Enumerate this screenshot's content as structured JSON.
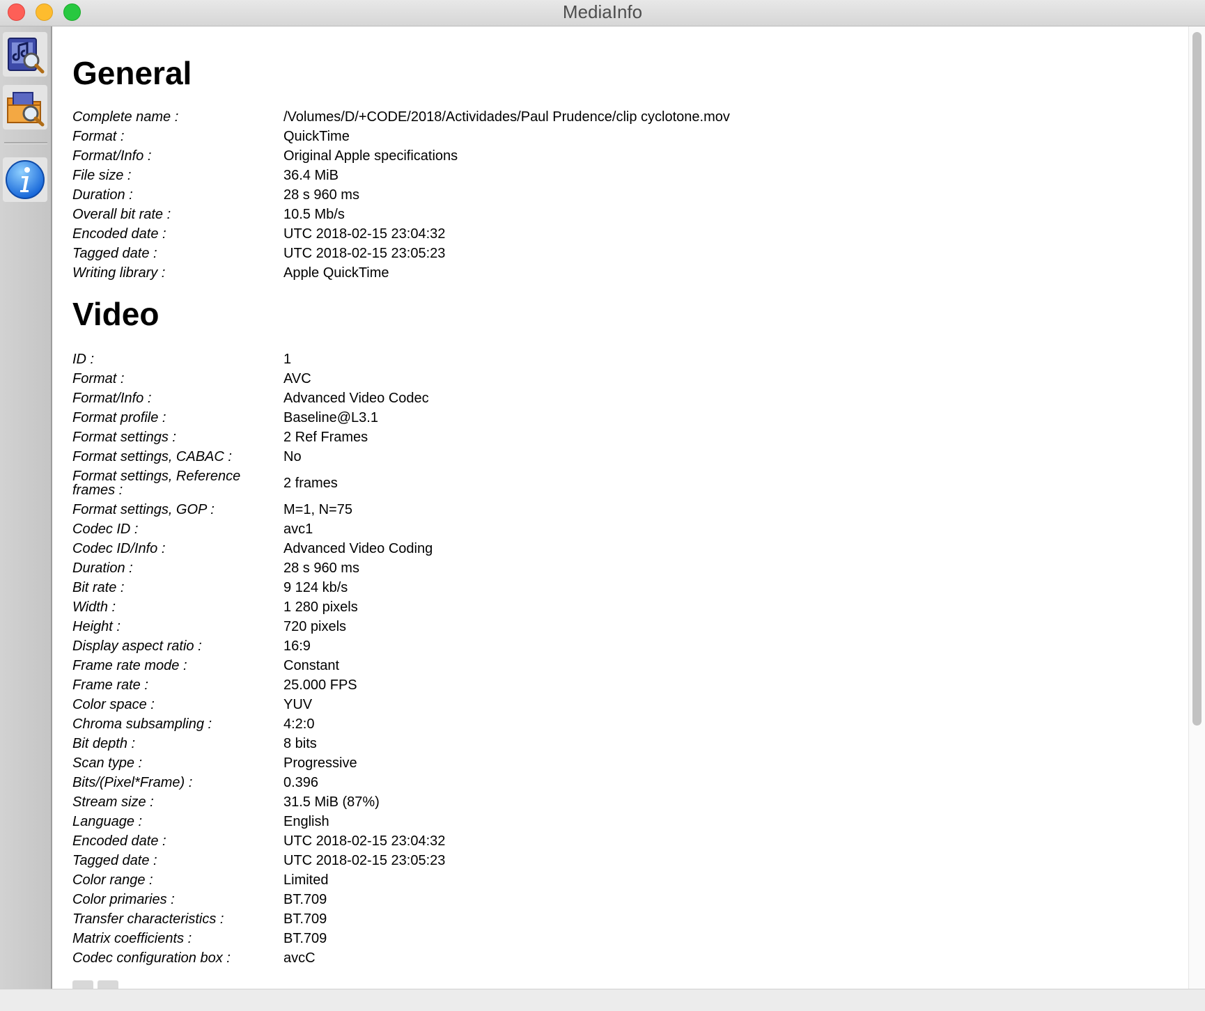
{
  "window": {
    "title": "MediaInfo"
  },
  "sidebar": {
    "buttons": [
      {
        "icon": "open-file-icon"
      },
      {
        "icon": "open-folder-icon"
      },
      {
        "icon": "info-icon"
      }
    ]
  },
  "general": {
    "heading": "General",
    "rows": [
      {
        "label": "Complete name :",
        "value": "/Volumes/D/+CODE/2018/Actividades/Paul Prudence/clip cyclotone.mov"
      },
      {
        "label": "Format :",
        "value": "QuickTime"
      },
      {
        "label": "Format/Info :",
        "value": "Original Apple specifications"
      },
      {
        "label": "File size :",
        "value": "36.4 MiB"
      },
      {
        "label": "Duration :",
        "value": "28 s 960 ms"
      },
      {
        "label": "Overall bit rate :",
        "value": "10.5 Mb/s"
      },
      {
        "label": "Encoded date :",
        "value": "UTC 2018-02-15 23:04:32"
      },
      {
        "label": "Tagged date :",
        "value": "UTC 2018-02-15 23:05:23"
      },
      {
        "label": "Writing library :",
        "value": "Apple QuickTime"
      }
    ]
  },
  "video": {
    "heading": "Video",
    "rows": [
      {
        "label": "ID :",
        "value": "1"
      },
      {
        "label": "Format :",
        "value": "AVC"
      },
      {
        "label": "Format/Info :",
        "value": "Advanced Video Codec"
      },
      {
        "label": "Format profile :",
        "value": "Baseline@L3.1"
      },
      {
        "label": "Format settings :",
        "value": "2 Ref Frames"
      },
      {
        "label": "Format settings, CABAC :",
        "value": "No"
      },
      {
        "label": "Format settings, Reference frames :",
        "value": "2 frames"
      },
      {
        "label": "Format settings, GOP :",
        "value": "M=1, N=75"
      },
      {
        "label": "Codec ID :",
        "value": "avc1"
      },
      {
        "label": "Codec ID/Info :",
        "value": "Advanced Video Coding"
      },
      {
        "label": "Duration :",
        "value": "28 s 960 ms"
      },
      {
        "label": "Bit rate :",
        "value": "9 124 kb/s"
      },
      {
        "label": "Width :",
        "value": "1 280 pixels"
      },
      {
        "label": "Height :",
        "value": "720 pixels"
      },
      {
        "label": "Display aspect ratio :",
        "value": "16:9"
      },
      {
        "label": "Frame rate mode :",
        "value": "Constant"
      },
      {
        "label": "Frame rate :",
        "value": "25.000 FPS"
      },
      {
        "label": "Color space :",
        "value": "YUV"
      },
      {
        "label": "Chroma subsampling :",
        "value": "4:2:0"
      },
      {
        "label": "Bit depth :",
        "value": "8 bits"
      },
      {
        "label": "Scan type :",
        "value": "Progressive"
      },
      {
        "label": "Bits/(Pixel*Frame) :",
        "value": "0.396"
      },
      {
        "label": "Stream size :",
        "value": "31.5 MiB (87%)"
      },
      {
        "label": "Language :",
        "value": "English"
      },
      {
        "label": "Encoded date :",
        "value": "UTC 2018-02-15 23:04:32"
      },
      {
        "label": "Tagged date :",
        "value": "UTC 2018-02-15 23:05:23"
      },
      {
        "label": "Color range :",
        "value": "Limited"
      },
      {
        "label": "Color primaries :",
        "value": "BT.709"
      },
      {
        "label": "Transfer characteristics :",
        "value": "BT.709"
      },
      {
        "label": "Matrix coefficients :",
        "value": "BT.709"
      },
      {
        "label": "Codec configuration box :",
        "value": "avcC"
      }
    ]
  }
}
